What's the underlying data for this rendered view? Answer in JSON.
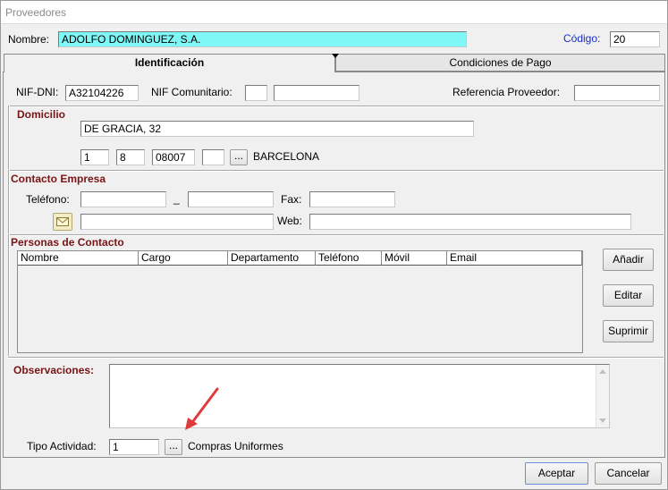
{
  "window": {
    "title": "Proveedores"
  },
  "header": {
    "nombre_label": "Nombre:",
    "nombre_value": "ADOLFO DOMINGUEZ, S.A.",
    "codigo_label": "Código:",
    "codigo_value": "20"
  },
  "tabs": [
    {
      "label": "Identificación",
      "active": true
    },
    {
      "label": "Condiciones de Pago",
      "active": false
    }
  ],
  "ident": {
    "nif_label": "NIF-DNI:",
    "nif_value": "A32104226",
    "nif_com_label": "NIF Comunitario:",
    "nif_com_prefix": "",
    "nif_com_value": "",
    "ref_label": "Referencia Proveedor:",
    "ref_value": ""
  },
  "domicilio": {
    "title": "Domicilio",
    "address": "DE GRACIA, 32",
    "f1": "1",
    "f2": "8",
    "postal_code": "08007",
    "f4": "",
    "lookup_label": "...",
    "city": "BARCELONA"
  },
  "contacto": {
    "title": "Contacto Empresa",
    "telefono_label": "Teléfono:",
    "telefono1": "",
    "dash": "_",
    "telefono2": "",
    "fax_label": "Fax:",
    "fax": "",
    "email": "",
    "web_label": "Web:",
    "web": "",
    "email_icon": "envelope-icon"
  },
  "personas": {
    "title": "Personas de Contacto",
    "columns": [
      "Nombre",
      "Cargo",
      "Departamento",
      "Teléfono",
      "Móvil",
      "Email"
    ],
    "rows": [],
    "add_label": "Añadir",
    "edit_label": "Editar",
    "delete_label": "Suprimir"
  },
  "observaciones": {
    "label": "Observaciones:",
    "value": ""
  },
  "actividad": {
    "label": "Tipo Actividad:",
    "value": "1",
    "lookup_label": "...",
    "description": "Compras Uniformes"
  },
  "annotation": {
    "color": "#e03a3a",
    "icon": "red-arrow-icon"
  },
  "footer": {
    "accept_label": "Aceptar",
    "cancel_label": "Cancelar"
  }
}
